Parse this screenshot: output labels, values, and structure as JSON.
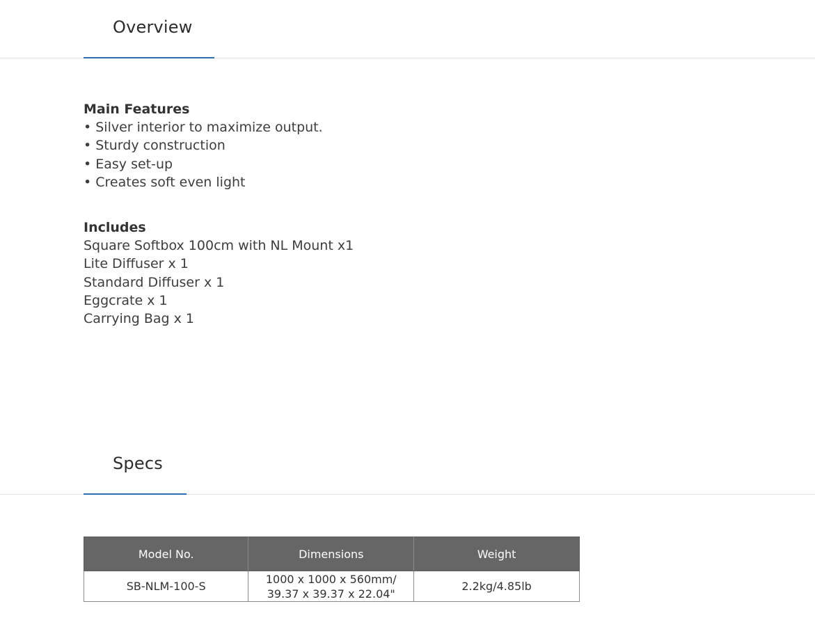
{
  "overview": {
    "tab_label": "Overview",
    "features_title": "Main Features",
    "features": [
      "• Silver interior to maximize output.",
      "• Sturdy construction",
      "• Easy set-up",
      "• Creates soft even light"
    ],
    "includes_title": "Includes",
    "includes": [
      "Square Softbox 100cm with NL Mount x1",
      "Lite Diffuser x 1",
      "Standard Diffuser x 1",
      "Eggcrate x 1",
      "Carrying Bag x 1"
    ]
  },
  "specs": {
    "tab_label": "Specs",
    "table": {
      "headers": [
        "Model No.",
        "Dimensions",
        "Weight"
      ],
      "rows": [
        {
          "model": "SB-NLM-100-S",
          "dimensions_line1": "1000 x 1000 x 560mm/",
          "dimensions_line2": "39.37 x 39.37 x 22.04\"",
          "weight": "2.2kg/4.85lb"
        }
      ]
    }
  },
  "colors": {
    "accent": "#2a6db5",
    "table_header_bg": "#666666",
    "divider": "#e3e3e3"
  }
}
